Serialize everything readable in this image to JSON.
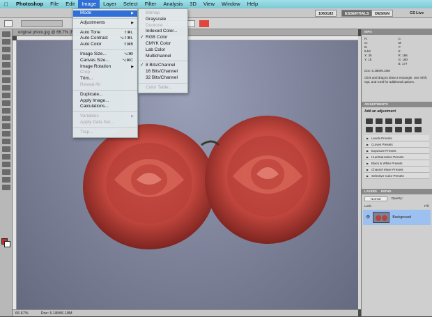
{
  "menubar": {
    "apple": "",
    "app": "Photoshop",
    "items": [
      "File",
      "Edit",
      "Image",
      "Layer",
      "Select",
      "Filter",
      "Analysis",
      "3D",
      "View",
      "Window",
      "Help"
    ],
    "active": "Image"
  },
  "appbar": {
    "size_label": "1063182",
    "workspace_essentials": "ESSENTIALS",
    "workspace_design": "DESIGN",
    "cs_live": "CS Live"
  },
  "document": {
    "tab": "original photo.jpg @ 66.7% (RGB/8)",
    "zoom": "66.67%",
    "doc_size": "Doc: 6.18M/6.18M"
  },
  "image_menu": {
    "items": [
      {
        "label": "Mode",
        "shortcut": "",
        "submenu": true,
        "disabled": false,
        "selected": true
      },
      {
        "sep": true
      },
      {
        "label": "Adjustments",
        "shortcut": "",
        "submenu": true,
        "disabled": false
      },
      {
        "sep": true
      },
      {
        "label": "Auto Tone",
        "shortcut": "⇧⌘L",
        "disabled": false
      },
      {
        "label": "Auto Contrast",
        "shortcut": "⌥⇧⌘L",
        "disabled": false
      },
      {
        "label": "Auto Color",
        "shortcut": "⇧⌘B",
        "disabled": false
      },
      {
        "sep": true
      },
      {
        "label": "Image Size...",
        "shortcut": "⌥⌘I",
        "disabled": false
      },
      {
        "label": "Canvas Size...",
        "shortcut": "⌥⌘C",
        "disabled": false
      },
      {
        "label": "Image Rotation",
        "shortcut": "",
        "submenu": true,
        "disabled": false
      },
      {
        "label": "Crop",
        "shortcut": "",
        "disabled": true
      },
      {
        "label": "Trim...",
        "shortcut": "",
        "disabled": false
      },
      {
        "label": "Reveal All",
        "shortcut": "",
        "disabled": true
      },
      {
        "sep": true
      },
      {
        "label": "Duplicate...",
        "shortcut": "",
        "disabled": false
      },
      {
        "label": "Apply Image...",
        "shortcut": "",
        "disabled": false
      },
      {
        "label": "Calculations...",
        "shortcut": "",
        "disabled": false
      },
      {
        "sep": true
      },
      {
        "label": "Variables",
        "shortcut": "",
        "submenu": true,
        "disabled": true
      },
      {
        "label": "Apply Data Set...",
        "shortcut": "",
        "disabled": true
      },
      {
        "sep": true
      },
      {
        "label": "Trap...",
        "shortcut": "",
        "disabled": true
      }
    ]
  },
  "mode_menu": {
    "items": [
      {
        "label": "Bitmap",
        "disabled": true
      },
      {
        "label": "Grayscale",
        "disabled": false
      },
      {
        "label": "Duotone",
        "disabled": true
      },
      {
        "label": "Indexed Color...",
        "disabled": false
      },
      {
        "label": "RGB Color",
        "disabled": false,
        "checked": true
      },
      {
        "label": "CMYK Color",
        "disabled": false
      },
      {
        "label": "Lab Color",
        "disabled": false
      },
      {
        "label": "Multichannel",
        "disabled": false
      },
      {
        "sep": true
      },
      {
        "label": "8 Bits/Channel",
        "disabled": false,
        "checked": true
      },
      {
        "label": "16 Bits/Channel",
        "disabled": false
      },
      {
        "label": "32 Bits/Channel",
        "disabled": false
      },
      {
        "sep": true
      },
      {
        "label": "Color Table...",
        "disabled": true
      }
    ]
  },
  "info_panel": {
    "tab": "INFO",
    "rows": [
      [
        "R:",
        "C:"
      ],
      [
        "G:",
        "M:"
      ],
      [
        "B:",
        "Y:"
      ],
      [
        "8-bit",
        "K:"
      ],
      [
        "X: 35",
        "R: 186"
      ],
      [
        "Y: 15",
        "G: 180"
      ],
      [
        "",
        "B: 177"
      ]
    ],
    "doc": "Doc: 6.18M/6.18M",
    "hint": "Click and drag to draw a rectangle. Use Shift, Opt, and Cmd for additional options."
  },
  "adjustments_panel": {
    "tab": "ADJUSTMENTS",
    "title": "Add an adjustment",
    "presets": [
      "Levels Presets",
      "Curves Presets",
      "Exposure Presets",
      "Hue/Saturation Presets",
      "Black & White Presets",
      "Channel Mixer Presets",
      "Selective Color Presets"
    ]
  },
  "layers_panel": {
    "tabs": [
      "LAYERS",
      "PATHS"
    ],
    "blend": "Normal",
    "opacity_label": "Opacity:",
    "fill_label": "Fill:",
    "lock_label": "Lock:",
    "layer_name": "Background"
  }
}
